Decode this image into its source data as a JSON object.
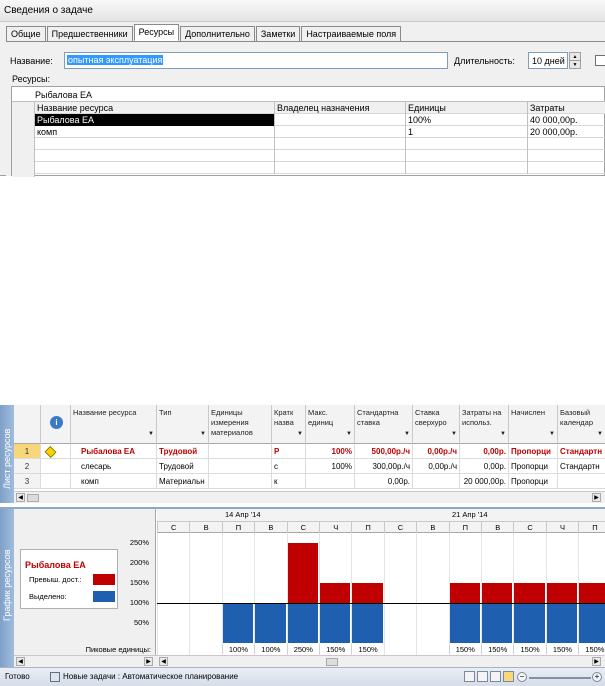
{
  "dialog": {
    "title": "Сведения о задаче",
    "tabs": [
      "Общие",
      "Предшественники",
      "Ресурсы",
      "Дополнительно",
      "Заметки",
      "Настраиваемые поля"
    ],
    "active_tab": "Ресурсы",
    "name_label": "Название:",
    "name_value": "опытная эксплуатация",
    "duration_label": "Длительность:",
    "duration_value": "10 дней",
    "resources_label": "Ресурсы:",
    "edit_value": "Рыбалова ЕА",
    "columns": [
      "Название ресурса",
      "Владелец назначения",
      "Единицы",
      "Затраты"
    ],
    "rows": [
      [
        "Рыбалова ЕА",
        "",
        "100%",
        "40 000,00р."
      ],
      [
        "комп",
        "",
        "1",
        "20 000,00р."
      ]
    ]
  },
  "sheet": {
    "side_label": "Лист ресурсов",
    "columns": [
      "Название ресурса",
      "Тип",
      "Единицы измерения материалов",
      "Кратк назва",
      "Макс. единиц",
      "Стандартна ставка",
      "Ставка сверхуро",
      "Затраты на использ.",
      "Начислен",
      "Базовый календар"
    ],
    "rows": [
      {
        "num": "1",
        "name": "Рыбалова ЕА",
        "type": "Трудовой",
        "mat": "",
        "short": "Р",
        "max": "100%",
        "std": "500,00р./ч",
        "ovt": "0,00р./ч",
        "cost": "0,00р.",
        "accrue": "Пропорци",
        "cal": "Стандартн",
        "over": true
      },
      {
        "num": "2",
        "name": "слесарь",
        "type": "Трудовой",
        "mat": "",
        "short": "с",
        "max": "100%",
        "std": "300,00р./ч",
        "ovt": "0,00р./ч",
        "cost": "0,00р.",
        "accrue": "Пропорци",
        "cal": "Стандартн",
        "over": false
      },
      {
        "num": "3",
        "name": "комп",
        "type": "Материальн",
        "mat": "",
        "short": "к",
        "max": "",
        "std": "0,00р.",
        "ovt": "",
        "cost": "20 000,00р.",
        "accrue": "Пропорци",
        "cal": "",
        "over": false
      }
    ]
  },
  "graph": {
    "side_label": "График ресурсов",
    "resource_name": "Рыбалова ЕА",
    "legend_over": "Превыш. дост.:",
    "legend_alloc": "Выделено:",
    "peak_label": "Пиковые единицы:",
    "weeks": [
      "14 Апр '14",
      "21 Апр '14"
    ],
    "days": [
      "С",
      "В",
      "П",
      "В",
      "С",
      "Ч",
      "П",
      "С",
      "В",
      "П",
      "В",
      "С",
      "Ч",
      "П"
    ],
    "y_ticks": [
      "250%",
      "200%",
      "150%",
      "100%",
      "50%"
    ]
  },
  "chart_data": {
    "type": "bar",
    "categories": [
      "С",
      "В",
      "П",
      "В",
      "С",
      "Ч",
      "П",
      "С",
      "В",
      "П",
      "В",
      "С",
      "Ч",
      "П"
    ],
    "series": [
      {
        "name": "Выделено",
        "values": [
          0,
          0,
          100,
          100,
          100,
          100,
          100,
          0,
          0,
          100,
          100,
          100,
          100,
          100
        ],
        "color": "#1f5fb0"
      },
      {
        "name": "Превыш. дост.",
        "values": [
          0,
          0,
          0,
          0,
          150,
          50,
          50,
          0,
          0,
          50,
          50,
          50,
          50,
          50
        ],
        "color": "#c00000"
      }
    ],
    "peak_labels": [
      "",
      "",
      "100%",
      "100%",
      "250%",
      "150%",
      "150%",
      "",
      "",
      "150%",
      "150%",
      "150%",
      "150%",
      "150%"
    ],
    "ylim": [
      0,
      275
    ],
    "max_units_line": 100
  },
  "status": {
    "ready": "Готово",
    "new_tasks": "Новые задачи : Автоматическое планирование"
  }
}
